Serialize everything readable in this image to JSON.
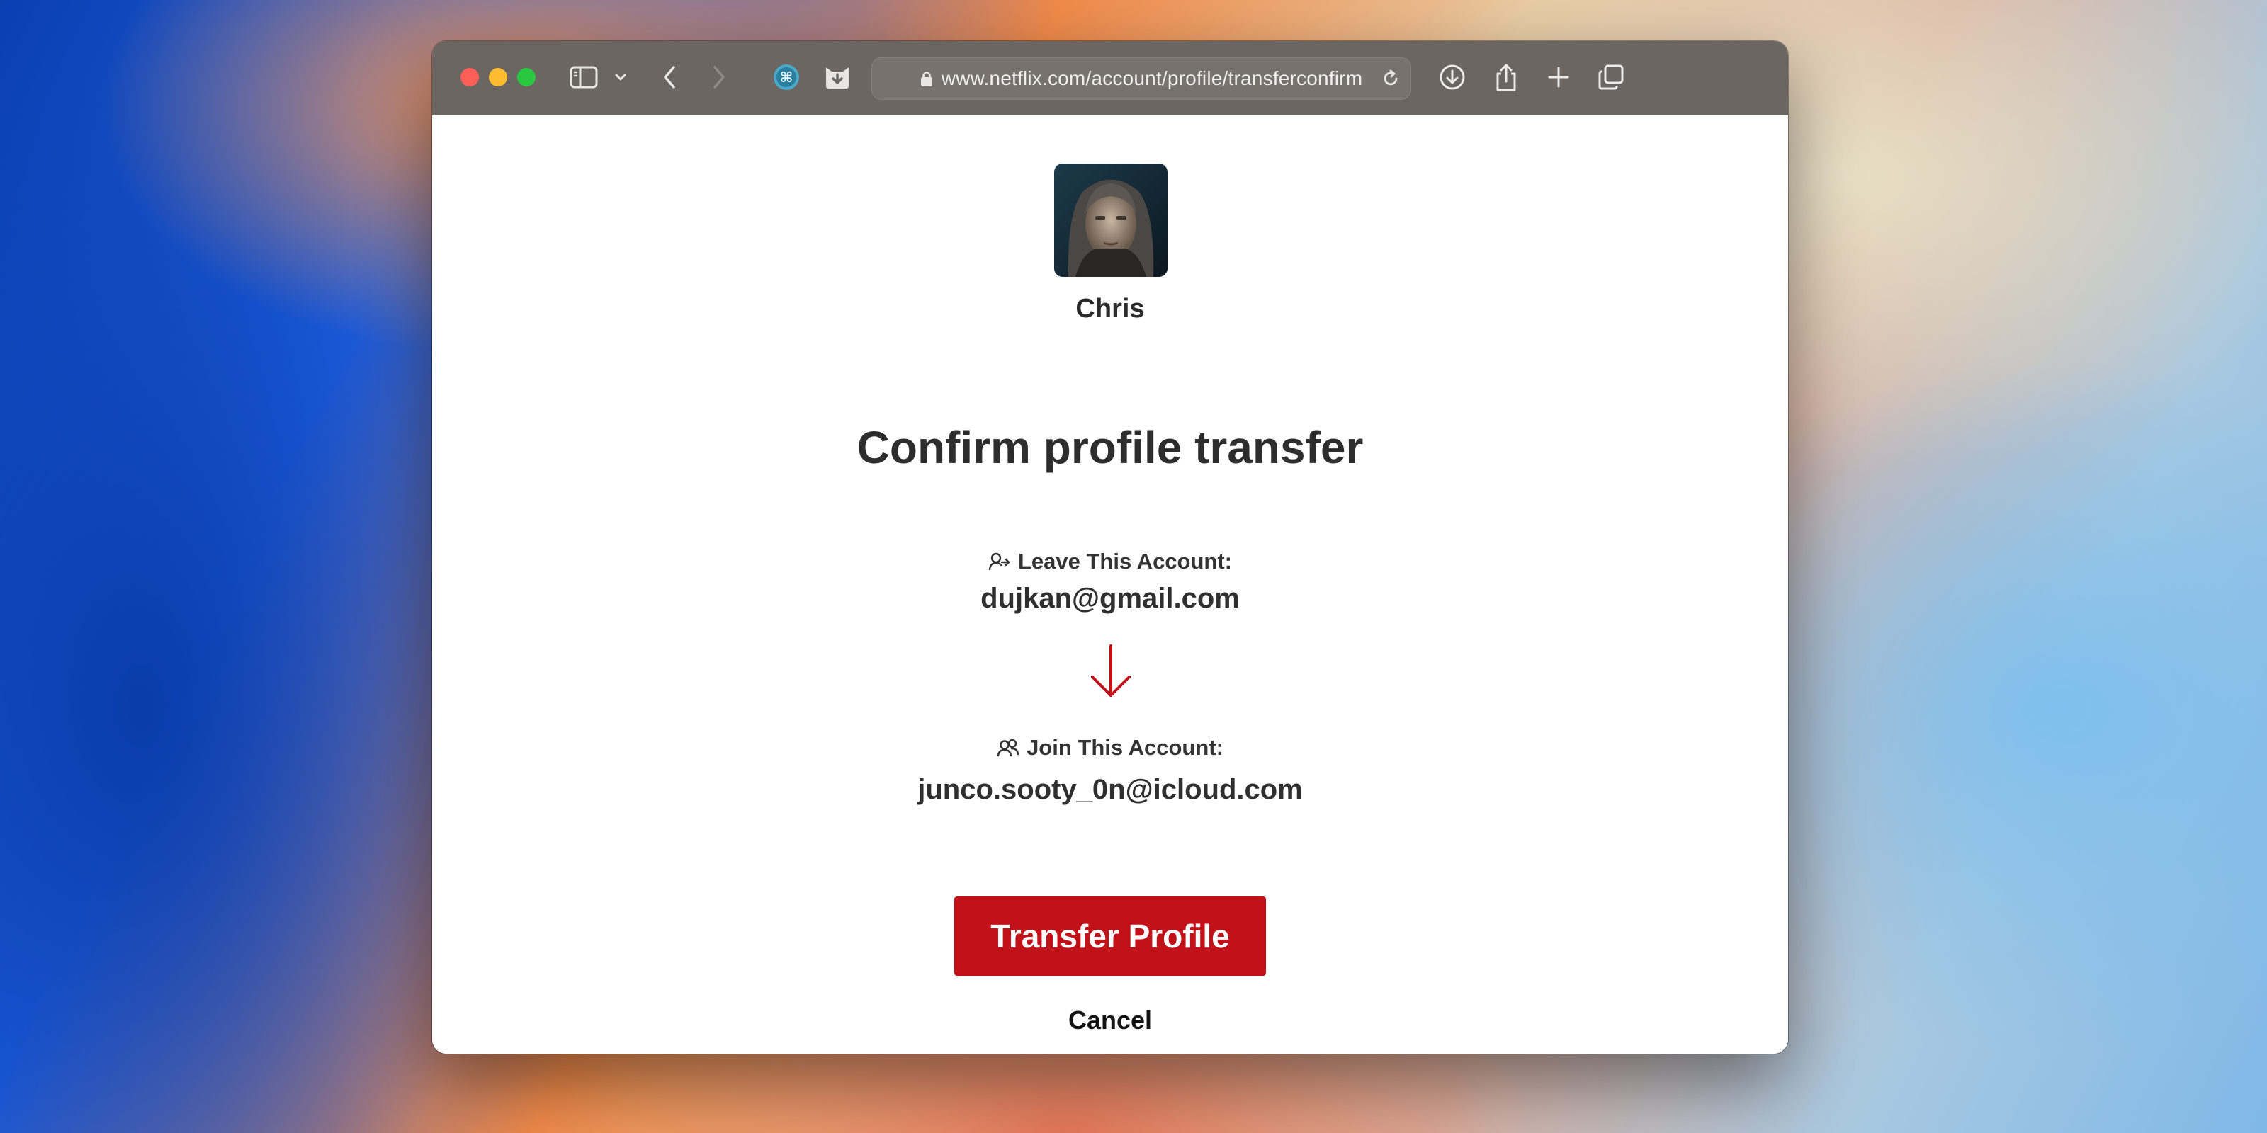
{
  "browser": {
    "url": "www.netflix.com/account/profile/transferconfirm",
    "icons": [
      "sidebar-icon",
      "chevron-down-icon",
      "back-icon",
      "forward-icon",
      "extension-icon",
      "extension-cat-icon",
      "lock-icon",
      "reload-icon",
      "download-icon",
      "share-icon",
      "new-tab-icon",
      "tabs-overview-icon"
    ]
  },
  "profile": {
    "name": "Chris"
  },
  "page": {
    "title": "Confirm profile transfer",
    "leave_label": "Leave This Account:",
    "leave_email": "dujkan@gmail.com",
    "join_label": "Join This Account:",
    "join_email": "junco.sooty_0n@icloud.com",
    "transfer_button": "Transfer Profile",
    "cancel_button": "Cancel"
  },
  "colors": {
    "accent": "#c11119",
    "toolbar": "#6b6662"
  }
}
